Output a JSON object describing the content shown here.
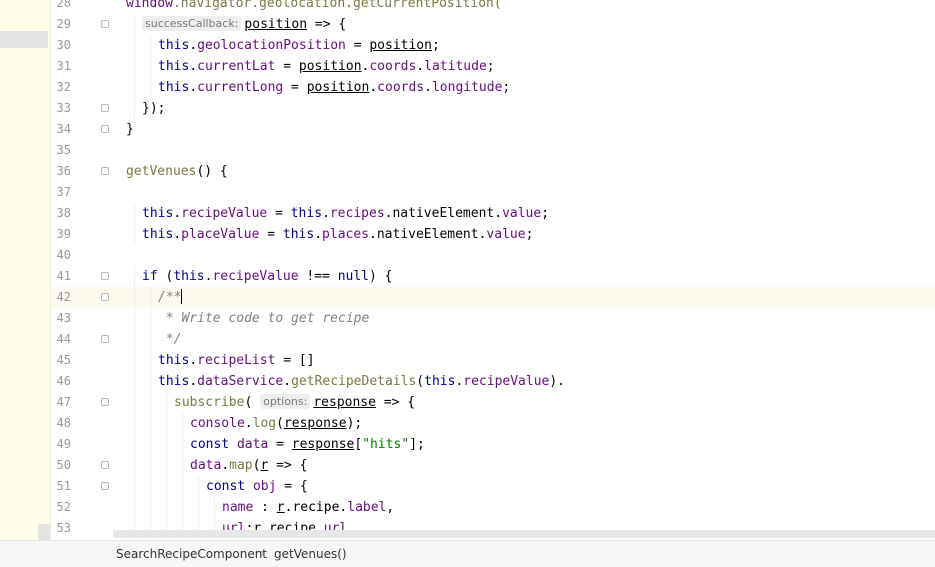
{
  "editor": {
    "lines": [
      {
        "n": "28",
        "tokens": [
          {
            "t": "window",
            "c": "p"
          },
          {
            "t": ".navigator.geolocation.getCurrentPosition(",
            "c": "f"
          }
        ],
        "indent": 1,
        "fold": false
      },
      {
        "n": "29",
        "tokens": [
          {
            "hint": "successCallback:"
          },
          {
            "t": "position",
            "u": true
          },
          {
            "t": " => {"
          }
        ],
        "indent": 2,
        "fold": true
      },
      {
        "n": "30",
        "tokens": [
          {
            "t": "this",
            "c": "k"
          },
          {
            "t": "."
          },
          {
            "t": "geolocationPosition",
            "c": "p"
          },
          {
            "t": " = "
          },
          {
            "t": "position",
            "u": true
          },
          {
            "t": ";"
          }
        ],
        "indent": 3
      },
      {
        "n": "31",
        "tokens": [
          {
            "t": "this",
            "c": "k"
          },
          {
            "t": "."
          },
          {
            "t": "currentLat",
            "c": "p"
          },
          {
            "t": " = "
          },
          {
            "t": "position",
            "u": true
          },
          {
            "t": "."
          },
          {
            "t": "coords",
            "c": "p"
          },
          {
            "t": "."
          },
          {
            "t": "latitude",
            "c": "p"
          },
          {
            "t": ";"
          }
        ],
        "indent": 3
      },
      {
        "n": "32",
        "tokens": [
          {
            "t": "this",
            "c": "k"
          },
          {
            "t": "."
          },
          {
            "t": "currentLong",
            "c": "p"
          },
          {
            "t": " = "
          },
          {
            "t": "position",
            "u": true
          },
          {
            "t": "."
          },
          {
            "t": "coords",
            "c": "p"
          },
          {
            "t": "."
          },
          {
            "t": "longitude",
            "c": "p"
          },
          {
            "t": ";"
          }
        ],
        "indent": 3
      },
      {
        "n": "33",
        "tokens": [
          {
            "t": "});"
          }
        ],
        "indent": 2,
        "fold": true
      },
      {
        "n": "34",
        "tokens": [
          {
            "t": "}"
          }
        ],
        "indent": 1,
        "fold": true
      },
      {
        "n": "35",
        "tokens": [],
        "indent": 0
      },
      {
        "n": "36",
        "tokens": [
          {
            "t": "getVenues",
            "c": "f"
          },
          {
            "t": "() {"
          }
        ],
        "indent": 1,
        "fold": true
      },
      {
        "n": "37",
        "tokens": [],
        "indent": 0
      },
      {
        "n": "38",
        "tokens": [
          {
            "t": "this",
            "c": "k"
          },
          {
            "t": "."
          },
          {
            "t": "recipeValue",
            "c": "p"
          },
          {
            "t": " = "
          },
          {
            "t": "this",
            "c": "k"
          },
          {
            "t": "."
          },
          {
            "t": "recipes",
            "c": "p"
          },
          {
            "t": ".nativeElement."
          },
          {
            "t": "value",
            "c": "p"
          },
          {
            "t": ";"
          }
        ],
        "indent": 2
      },
      {
        "n": "39",
        "tokens": [
          {
            "t": "this",
            "c": "k"
          },
          {
            "t": "."
          },
          {
            "t": "placeValue",
            "c": "p"
          },
          {
            "t": " = "
          },
          {
            "t": "this",
            "c": "k"
          },
          {
            "t": "."
          },
          {
            "t": "places",
            "c": "p"
          },
          {
            "t": ".nativeElement."
          },
          {
            "t": "value",
            "c": "p"
          },
          {
            "t": ";"
          }
        ],
        "indent": 2
      },
      {
        "n": "40",
        "tokens": [],
        "indent": 0
      },
      {
        "n": "41",
        "tokens": [
          {
            "t": "if",
            "c": "k"
          },
          {
            "t": " ("
          },
          {
            "t": "this",
            "c": "k"
          },
          {
            "t": "."
          },
          {
            "t": "recipeValue",
            "c": "p"
          },
          {
            "t": " !== "
          },
          {
            "t": "null",
            "c": "k"
          },
          {
            "t": ") {"
          }
        ],
        "indent": 2,
        "fold": true
      },
      {
        "n": "42",
        "tokens": [
          {
            "t": "/**",
            "c": "c"
          },
          {
            "caret": true
          }
        ],
        "indent": 3,
        "fold": true,
        "current": true
      },
      {
        "n": "43",
        "tokens": [
          {
            "t": " * Write code to get recipe",
            "c": "c"
          }
        ],
        "indent": 3
      },
      {
        "n": "44",
        "tokens": [
          {
            "t": " */",
            "c": "c"
          }
        ],
        "indent": 3,
        "fold": true
      },
      {
        "n": "45",
        "tokens": [
          {
            "t": "this",
            "c": "k"
          },
          {
            "t": "."
          },
          {
            "t": "recipeList",
            "c": "p"
          },
          {
            "t": " = []"
          }
        ],
        "indent": 3
      },
      {
        "n": "46",
        "tokens": [
          {
            "t": "this",
            "c": "k"
          },
          {
            "t": "."
          },
          {
            "t": "dataService",
            "c": "p"
          },
          {
            "t": "."
          },
          {
            "t": "getRecipeDetails",
            "c": "f"
          },
          {
            "t": "("
          },
          {
            "t": "this",
            "c": "k"
          },
          {
            "t": "."
          },
          {
            "t": "recipeValue",
            "c": "p"
          },
          {
            "t": ")."
          }
        ],
        "indent": 3
      },
      {
        "n": "47",
        "tokens": [
          {
            "t": "subscribe",
            "c": "f"
          },
          {
            "t": "( "
          },
          {
            "hint": "options:"
          },
          {
            "t": "response",
            "u": true
          },
          {
            "t": " => {"
          }
        ],
        "indent": 4,
        "fold": true
      },
      {
        "n": "48",
        "tokens": [
          {
            "t": "console",
            "c": "p"
          },
          {
            "t": "."
          },
          {
            "t": "log",
            "c": "f"
          },
          {
            "t": "("
          },
          {
            "t": "response",
            "u": true
          },
          {
            "t": ");"
          }
        ],
        "indent": 5
      },
      {
        "n": "49",
        "tokens": [
          {
            "t": "const",
            "c": "k"
          },
          {
            "t": " "
          },
          {
            "t": "data",
            "c": "p"
          },
          {
            "t": " = "
          },
          {
            "t": "response",
            "u": true
          },
          {
            "t": "["
          },
          {
            "t": "\"hits\"",
            "c": "s"
          },
          {
            "t": "];"
          }
        ],
        "indent": 5
      },
      {
        "n": "50",
        "tokens": [
          {
            "t": "data",
            "c": "p"
          },
          {
            "t": "."
          },
          {
            "t": "map",
            "c": "f"
          },
          {
            "t": "("
          },
          {
            "t": "r",
            "u": true
          },
          {
            "t": " => {"
          }
        ],
        "indent": 5,
        "fold": true
      },
      {
        "n": "51",
        "tokens": [
          {
            "t": "const",
            "c": "k"
          },
          {
            "t": " "
          },
          {
            "t": "obj",
            "c": "p"
          },
          {
            "t": " = {"
          }
        ],
        "indent": 6,
        "fold": true
      },
      {
        "n": "52",
        "tokens": [
          {
            "t": "name",
            "c": "p"
          },
          {
            "t": " : "
          },
          {
            "t": "r",
            "u": true
          },
          {
            "t": ".recipe."
          },
          {
            "t": "label",
            "c": "p"
          },
          {
            "t": ","
          }
        ],
        "indent": 7
      },
      {
        "n": "53",
        "tokens": [
          {
            "t": "url",
            "c": "p"
          },
          {
            "t": ":"
          },
          {
            "t": "r",
            "u": true
          },
          {
            "t": ".recipe."
          },
          {
            "t": "url",
            "c": "p"
          },
          {
            "t": ","
          }
        ],
        "indent": 7
      }
    ]
  },
  "breadcrumb": {
    "items": [
      "SearchRecipeComponent",
      "getVenues()"
    ],
    "separator": "›"
  }
}
